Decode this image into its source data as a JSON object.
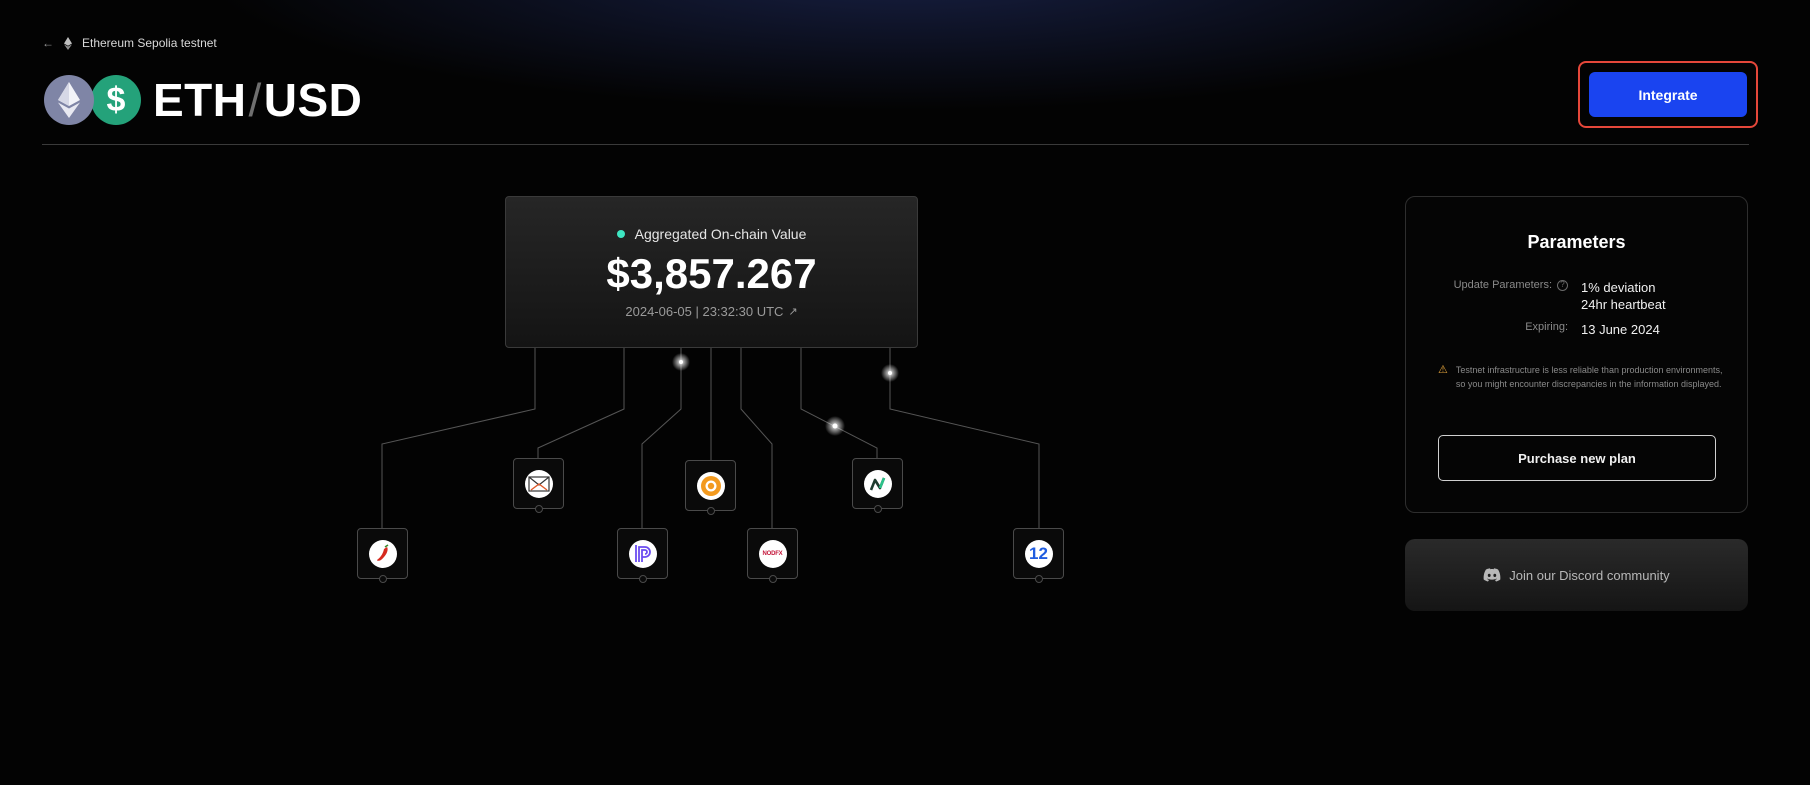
{
  "breadcrumb": {
    "back_icon": "arrow-left-icon",
    "network_icon": "ethereum-icon",
    "network": "Ethereum Sepolia testnet"
  },
  "header": {
    "base": "ETH",
    "separator": "/",
    "quote": "USD",
    "base_icon": "ethereum-icon",
    "quote_icon": "dollar-icon",
    "quote_symbol": "$",
    "integrate_label": "Integrate"
  },
  "feed": {
    "status_color": "#3ee6c2",
    "label": "Aggregated On-chain Value",
    "value": "$3,857.267",
    "timestamp": "2024-06-05 | 23:32:30 UTC",
    "link_icon": "external-link-icon"
  },
  "nodes": [
    {
      "icon": "chili-pepper-logo-icon"
    },
    {
      "icon": "envelope-logo-icon"
    },
    {
      "icon": "layered-p-logo-icon"
    },
    {
      "icon": "orange-ring-logo-icon"
    },
    {
      "icon": "nodefx-logo-icon",
      "text": "NODFX"
    },
    {
      "icon": "green-n-logo-icon"
    },
    {
      "icon": "blue-12-logo-icon",
      "text": "12"
    }
  ],
  "parameters": {
    "title": "Parameters",
    "update_label": "Update Parameters:",
    "update_values": [
      "1% deviation",
      "24hr heartbeat"
    ],
    "expiring_label": "Expiring:",
    "expiring_value": "13 June 2024",
    "warning": "Testnet infrastructure is less reliable than production environments, so you might encounter discrepancies in the information displayed.",
    "purchase_label": "Purchase new plan"
  },
  "discord": {
    "icon": "discord-icon",
    "label": "Join our Discord community"
  },
  "colors": {
    "accent": "#1a44f0",
    "highlight_border": "#e5473a",
    "eth": "#7f85a6",
    "usd": "#24a27a"
  }
}
